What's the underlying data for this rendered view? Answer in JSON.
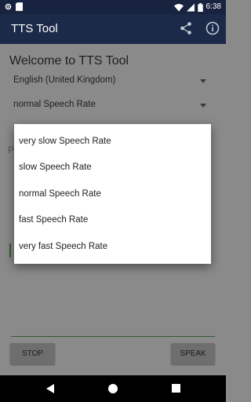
{
  "status_bar": {
    "time": "6:38",
    "icons": [
      "gear-icon",
      "sd-card-icon",
      "wifi-icon",
      "signal-icon",
      "battery-icon"
    ]
  },
  "app_bar": {
    "title": "TTS Tool",
    "icons": [
      "share-icon",
      "info-icon"
    ]
  },
  "main": {
    "welcome": "Welcome to TTS Tool",
    "language_spinner": "English (United Kingdom)",
    "rate_spinner": "normal Speech Rate",
    "partial_label": "P"
  },
  "buttons": {
    "stop": "STOP",
    "speak": "SPEAK"
  },
  "rate_dialog": {
    "options": [
      "very slow Speech Rate",
      "slow Speech Rate",
      "normal Speech Rate",
      "fast Speech Rate",
      "very fast Speech Rate"
    ]
  },
  "nav_bar": {
    "icons": [
      "back-icon",
      "home-icon",
      "recents-icon"
    ]
  },
  "colors": {
    "status_bar": "#18233f",
    "app_bar": "#1c2a4a",
    "scrim_background": "#8a8a8a",
    "dialog": "#ffffff"
  }
}
